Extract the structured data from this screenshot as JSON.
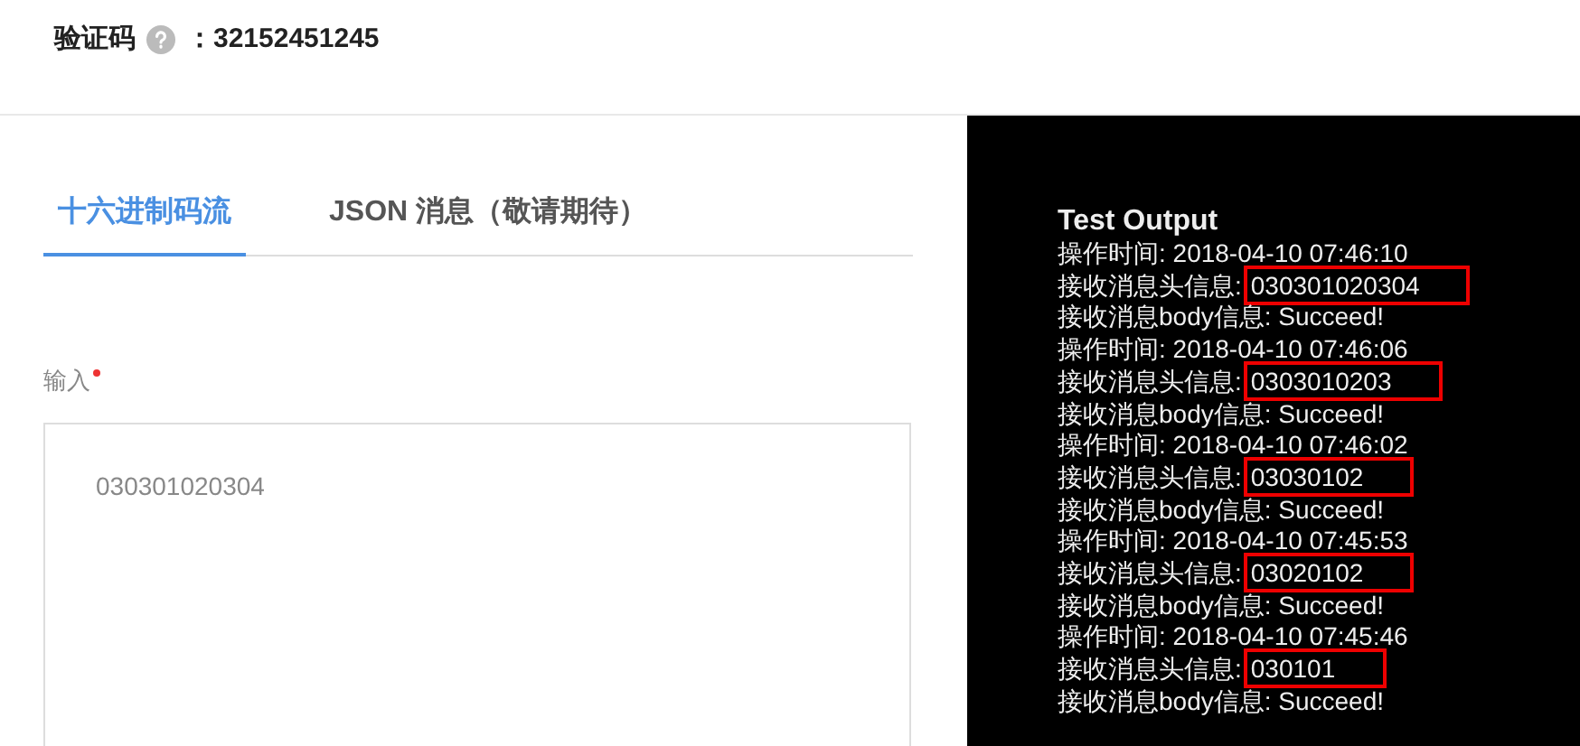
{
  "header": {
    "label": "验证码",
    "value": "：32152451245"
  },
  "tabs": [
    {
      "label": "十六进制码流",
      "selected": true
    },
    {
      "label": "JSON 消息（敬请期待）",
      "selected": false
    }
  ],
  "input": {
    "label": "输入",
    "required": true,
    "placeholder": "030301020304"
  },
  "output": {
    "title": "Test Output",
    "lines": [
      {
        "kind": "time",
        "text": "操作时间: 2018-04-10 07:46:10"
      },
      {
        "kind": "head",
        "text": "接收消息头信息:",
        "value": "030301020304"
      },
      {
        "kind": "body",
        "text": "接收消息body信息: Succeed!"
      },
      {
        "kind": "time",
        "text": "操作时间: 2018-04-10 07:46:06"
      },
      {
        "kind": "head",
        "text": "接收消息头信息:",
        "value": "0303010203"
      },
      {
        "kind": "body",
        "text": "接收消息body信息: Succeed!"
      },
      {
        "kind": "time",
        "text": "操作时间: 2018-04-10 07:46:02"
      },
      {
        "kind": "head",
        "text": "接收消息头信息:",
        "value": "03030102"
      },
      {
        "kind": "body",
        "text": "接收消息body信息: Succeed!"
      },
      {
        "kind": "time",
        "text": "操作时间: 2018-04-10 07:45:53"
      },
      {
        "kind": "head",
        "text": "接收消息头信息:",
        "value": "03020102"
      },
      {
        "kind": "body",
        "text": "接收消息body信息: Succeed!"
      },
      {
        "kind": "time",
        "text": "操作时间: 2018-04-10 07:45:46"
      },
      {
        "kind": "head",
        "text": "接收消息头信息:",
        "value": "030101"
      },
      {
        "kind": "body",
        "text": "接收消息body信息: Succeed!"
      }
    ]
  }
}
